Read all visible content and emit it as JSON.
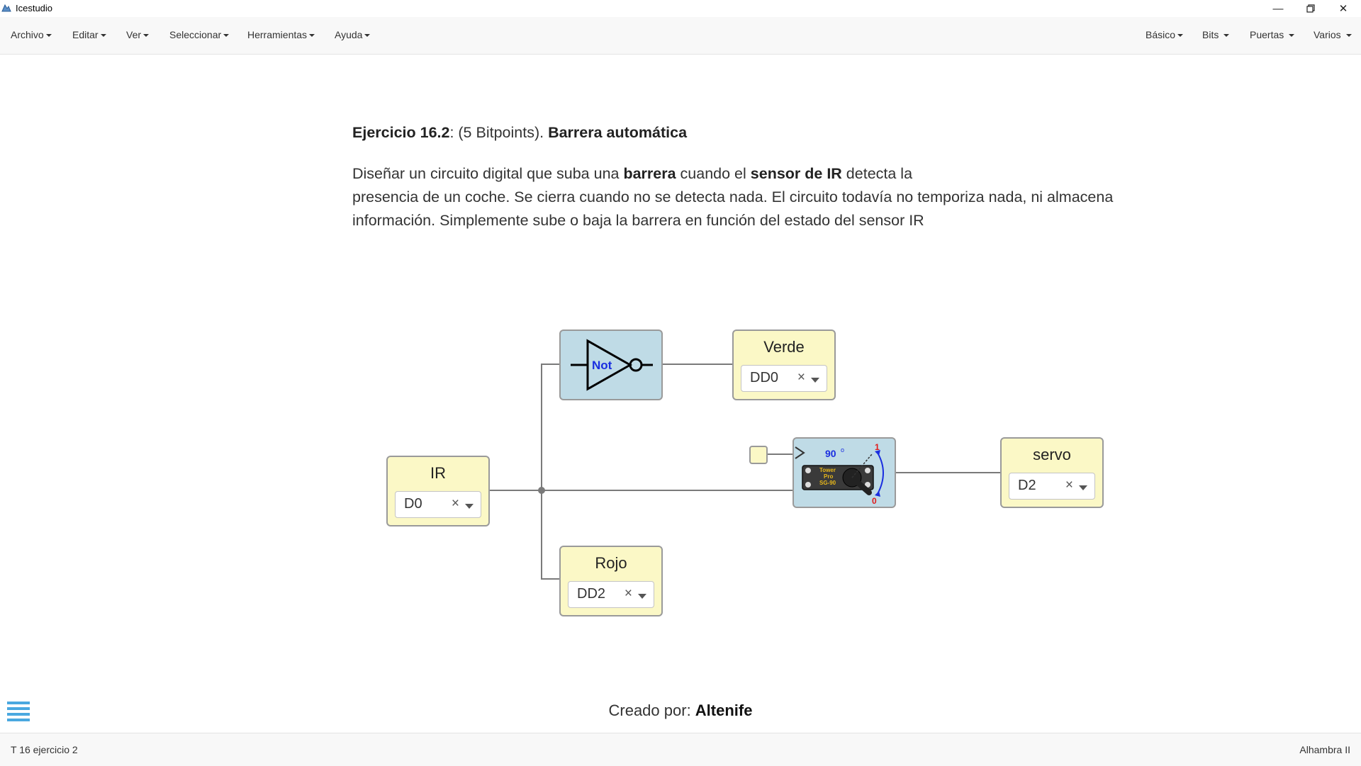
{
  "window": {
    "title": "Icestudio"
  },
  "menu": {
    "left": [
      "Archivo",
      "Editar",
      "Ver",
      "Seleccionar",
      "Herramientas",
      "Ayuda"
    ],
    "right": [
      "Básico",
      "Bits",
      "Puertas",
      "Varios"
    ]
  },
  "description": {
    "heading_bold_1": "Ejercicio 16.2",
    "heading_normal": ": (5 Bitpoints). ",
    "heading_bold_2": "Barrera automática",
    "line1_a": "Diseñar un circuito digital que suba una ",
    "line1_b": "barrera",
    "line1_c": " cuando el ",
    "line1_d": "sensor de IR",
    "line1_e": " detecta la",
    "line2": "presencia de un coche. Se cierra cuando no se detecta nada. El circuito todavía no temporiza nada, ni almacena",
    "line3": "información. Simplemente sube o baja la barrera en función del estado del sensor IR"
  },
  "circuit": {
    "blocks": {
      "ir": {
        "label": "IR",
        "pin": "D0"
      },
      "verde": {
        "label": "Verde",
        "pin": "DD0"
      },
      "rojo": {
        "label": "Rojo",
        "pin": "DD2"
      },
      "servo": {
        "label": "servo",
        "pin": "D2"
      },
      "not_gate": {
        "label": "Not"
      },
      "servo_module": {
        "angle": "90",
        "degree_mark": "o",
        "top_value": "1",
        "bottom_value": "0",
        "brand_1": "Tower",
        "brand_2": "Pro",
        "brand_3": "SG-90"
      }
    },
    "clear_symbol": "×"
  },
  "footer": {
    "credit_prefix": "Creado por: ",
    "credit_name": "Altenife"
  },
  "statusbar": {
    "left": "T 16 ejercicio 2",
    "right": "Alhambra II"
  },
  "icons": {
    "app": "icestudio-logo-icon",
    "minimize": "minimize-icon",
    "restore": "restore-icon",
    "close": "close-icon",
    "menu_toggle": "hamburger-menu-icon"
  },
  "colors": {
    "io_block": "#fbf8c6",
    "logic_block": "#bfdbe6",
    "wire": "#7a7a7a",
    "accent_hamburger": "#4aa8e0",
    "not_label": "#1a2ee0"
  }
}
